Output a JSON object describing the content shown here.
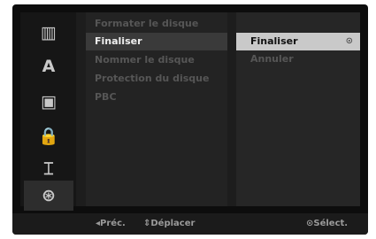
{
  "sidebar": {
    "icons": [
      {
        "name": "disc-library-icon",
        "glyph": "▥"
      },
      {
        "name": "language-icon",
        "glyph": "A"
      },
      {
        "name": "audio-speaker-icon",
        "glyph": "▣"
      },
      {
        "name": "parental-lock-icon",
        "glyph": "🔒"
      },
      {
        "name": "film-recording-icon",
        "glyph": "⌶"
      },
      {
        "name": "disc-settings-icon",
        "glyph": "⊛"
      }
    ],
    "selected_icon": "disc-settings-icon"
  },
  "menu": {
    "items": [
      {
        "label": "Formater le disque",
        "state": "disabled"
      },
      {
        "label": "Finaliser",
        "state": "selected"
      },
      {
        "label": "Nommer le disque",
        "state": "disabled"
      },
      {
        "label": "Protection du disque",
        "state": "disabled"
      },
      {
        "label": "PBC",
        "state": "disabled"
      }
    ]
  },
  "submenu": {
    "items": [
      {
        "label": "Finaliser",
        "state": "selected",
        "mark": "⊙"
      },
      {
        "label": "Annuler",
        "state": "disabled",
        "mark": ""
      }
    ]
  },
  "footer": {
    "prev": "◂Préc.",
    "move": "⇕Déplacer",
    "select": "⊙Sélect."
  }
}
